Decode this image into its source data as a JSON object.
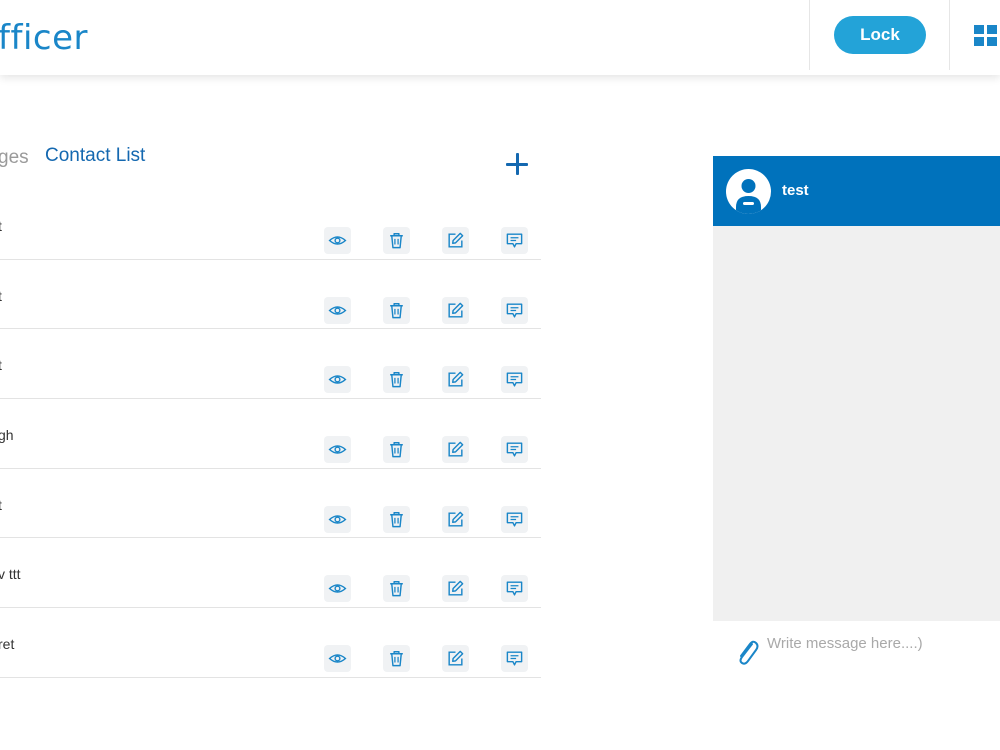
{
  "header": {
    "brand": "fficer",
    "lock_label": "Lock",
    "apps_icon": "grid-icon"
  },
  "tabs": {
    "messages": "ges",
    "contacts": "Contact List"
  },
  "add_icon": "plus-icon",
  "contacts": [
    {
      "name": "t"
    },
    {
      "name": "t"
    },
    {
      "name": "t"
    },
    {
      "name": "gh"
    },
    {
      "name": "t"
    },
    {
      "name": "v ttt"
    },
    {
      "name": "ret"
    }
  ],
  "row_actions": [
    "eye-icon",
    "trash-icon",
    "edit-icon",
    "chat-icon"
  ],
  "chat": {
    "contact_name": "test",
    "placeholder": "Write message here....)"
  },
  "colors": {
    "brand_blue": "#1a86c8",
    "lock_button": "#23a3d8",
    "chat_header": "#0072bc",
    "accent_text": "#1468b0",
    "icon_tile": "#f0f2f4",
    "chat_body": "#f0f0f0"
  }
}
